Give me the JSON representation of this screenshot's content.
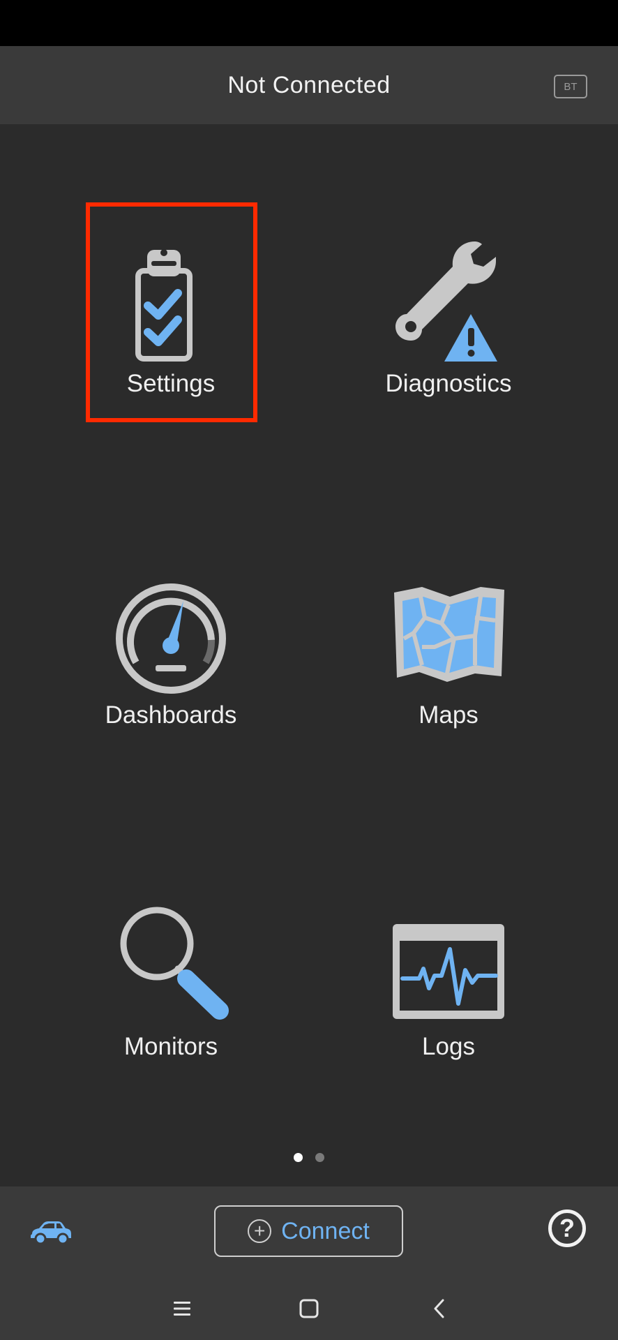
{
  "header": {
    "title": "Not Connected",
    "badge": "BT"
  },
  "tiles": [
    {
      "label": "Settings",
      "icon": "clipboard-check-icon"
    },
    {
      "label": "Diagnostics",
      "icon": "wrench-warning-icon"
    },
    {
      "label": "Dashboards",
      "icon": "gauge-icon"
    },
    {
      "label": "Maps",
      "icon": "map-icon"
    },
    {
      "label": "Monitors",
      "icon": "magnifier-icon"
    },
    {
      "label": "Logs",
      "icon": "waveform-icon"
    }
  ],
  "pager": {
    "pages": 2,
    "active_page": 1
  },
  "bottom_bar": {
    "connect_label": "Connect",
    "help_label": "?",
    "vehicle_icon": "car-icon"
  },
  "nav": [
    "menu-icon",
    "home-icon",
    "back-icon"
  ],
  "colors": {
    "accent": "#6fb3f2",
    "highlight": "#ff2a00",
    "icon_gray": "#c8c8c8",
    "background": "#2b2b2b"
  }
}
